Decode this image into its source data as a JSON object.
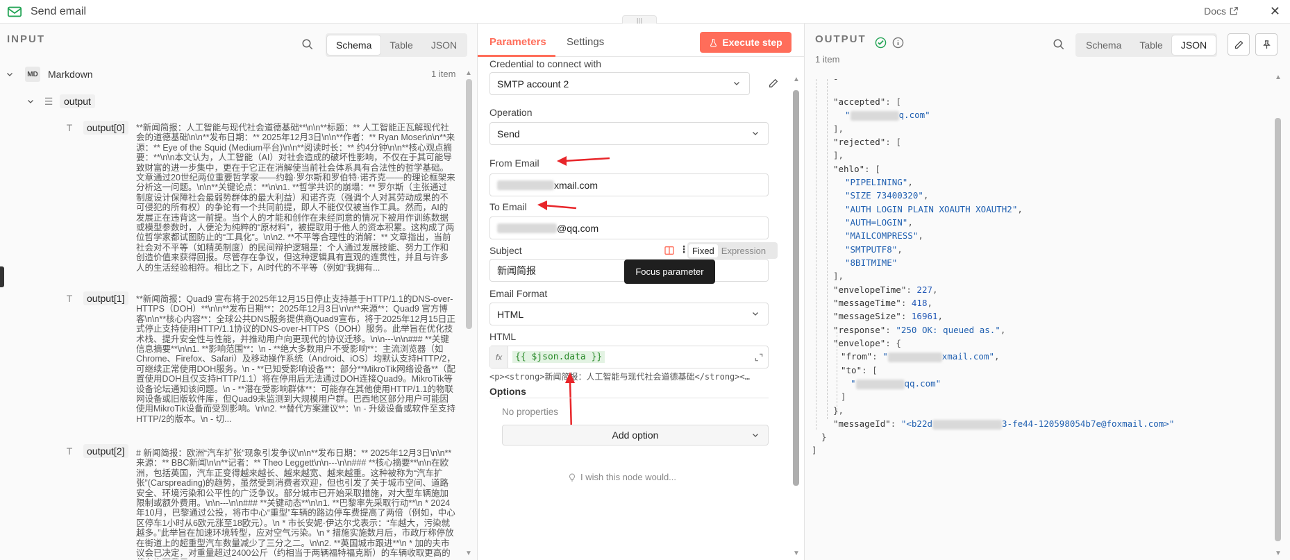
{
  "window": {
    "title": "Send email",
    "docs_label": "Docs",
    "close": "✕",
    "handle": "|||"
  },
  "input": {
    "header": "INPUT",
    "view_tabs": [
      "Schema",
      "Table",
      "JSON"
    ],
    "active_view": "Schema",
    "node": {
      "badge": "MD",
      "name": "Markdown",
      "count": "1 item"
    },
    "output_key": "output",
    "items": [
      {
        "key": "output[0]",
        "value": "**新闻简报：人工智能与现代社会道德基础**\\n\\n**标题：** 人工智能正瓦解现代社会的道德基础\\n\\n**发布日期：** 2025年12月3日\\n\\n**作者：** Ryan Moser\\n\\n**来源：** Eye of the Squid (Medium平台)\\n\\n**阅读时长：** 约4分钟\\n\\n**核心观点摘要：**\\n\\n本文认为，人工智能（AI）对社会造成的破坏性影响，不仅在于其可能导致财富的进一步集中，更在于它正在消解使当前社会体系具有合法性的哲学基础。文章通过20世纪两位重要哲学家——约翰·罗尔斯和罗伯特·诺齐克——的理论框架来分析这一问题。\\n\\n**关键论点：**\\n\\n1. **哲学共识的崩塌：** 罗尔斯（主张通过制度设计保障社会最弱势群体的最大利益）和诺齐克（强调个人对其劳动成果的不可侵犯的所有权）的争论有一个共同前提，即人不能仅仅被当作工具。然而，AI的发展正在违背这一前提。当个人的才能和创作在未经同意的情况下被用作训练数据或模型参数时，人便沦为纯粹的“原材料”，被提取用于他人的资本积累。这构成了两位哲学家都试图防止的“工具化”。\\n\\n2. **不平等合理性的消解：** 文章指出，当前社会对不平等（如精英制度）的民间辩护逻辑是：个人通过发展技能、努力工作和创造价值来获得回报。尽管存在争议，但这种逻辑具有直观的连贯性，并且与许多人的生活经验相符。相比之下，AI时代的不平等（例如“我拥有..."
      },
      {
        "key": "output[1]",
        "value": "**新闻简报：Quad9 宣布将于2025年12月15日停止支持基于HTTP/1.1的DNS-over-HTTPS（DOH）**\\n\\n**发布日期**：2025年12月3日\\n\\n**来源**：Quad9 官方博客\\n\\n**核心内容**：全球公共DNS服务提供商Quad9宣布，将于2025年12月15日正式停止支持使用HTTP/1.1协议的DNS-over-HTTPS（DOH）服务。此举旨在优化技术栈、提升安全性与性能，并推动用户向更现代的协议迁移。\\n\\n---\\n\\n### **关键信息摘要**\\n\\n1. **影响范围**：\\n - **绝大多数用户不受影响**：主流浏览器（如Chrome、Firefox、Safari）及移动操作系统（Android、iOS）均默认支持HTTP/2，可继续正常使用DOH服务。\\n - **已知受影响设备**：部分**MikroTik网络设备**（配置使用DOH且仅支持HTTP/1.1）将在停用后无法通过DOH连接Quad9。MikroTik等设备论坛通知该问题。\\n - **潜在受影响群体**：可能存在其他使用HTTP/1.1的物联网设备或旧版软件库，但Quad9未监测到大规模用户群。巴西地区部分用户可能因使用MikroTik设备而受到影响。\\n\\n2. **替代方案建议**：\\n - 升级设备或软件至支持HTTP/2的版本。\\n - 切..."
      },
      {
        "key": "output[2]",
        "value": "# 新闻简报：欧洲“汽车扩张”现象引发争议\\n\\n**发布日期：** 2025年12月3日\\n\\n**来源：** BBC新闻\\n\\n**记者：** Theo Leggett\\n\\n---\\n\\n### **核心摘要**\\n\\n在欧洲，包括英国，汽车正变得越来越长、越来越宽、越来越重。这种被称为“汽车扩张”(Carspreading)的趋势，虽然受到消费者欢迎，但也引发了关于城市空间、道路安全、环境污染和公平性的广泛争议。部分城市已开始采取措施，对大型车辆施加限制或额外费用。\\n\\n---\\n\\n### **关键动态**\\n\\n1. **巴黎率先采取行动**\\n * 2024年10月，巴黎通过公投，将市中心“重型”车辆的路边停车费提高了两倍（例如，中心区停车1小时从6欧元涨至18欧元）。\\n * 市长安妮·伊达尔戈表示：“车越大，污染就越多。”此举旨在加速环境转型，应对空气污染。\\n * 措施实施数月后，市政厅称停放在街道上的超重型汽车数量减少了三分之二。\\n\\n2. **英国城市跟进**\\n * 加的夫市议会已决定，对重量超过2400公斤（约相当于两辆福特福克斯）的车辆收取更高的停车许可费用..."
      }
    ]
  },
  "params": {
    "tabs": [
      "Parameters",
      "Settings"
    ],
    "active_tab": "Parameters",
    "execute_label": "Execute step",
    "credential_label": "Credential to connect with",
    "credential_value": "SMTP account 2",
    "operation_label": "Operation",
    "operation_value": "Send",
    "from_label": "From Email",
    "from_value_suffix": "xmail.com",
    "to_label": "To Email",
    "to_value_suffix": "@qq.com",
    "subject_label": "Subject",
    "subject_value": "新闻简报",
    "fixed_label": "Fixed",
    "expression_label": "Expression",
    "focus_tooltip": "Focus parameter",
    "format_label": "Email Format",
    "format_value": "HTML",
    "html_label": "HTML",
    "fx_label": "fx",
    "html_expression": "{{ $json.data }}",
    "html_preview": "<p><strong>新闻简报：人工智能与现代社会道德基础</strong><…",
    "options_label": "Options",
    "no_properties": "No properties",
    "add_option_label": "Add option",
    "feedback_label": "I wish this node would..."
  },
  "output": {
    "header": "OUTPUT",
    "view_tabs": [
      "Schema",
      "Table",
      "JSON"
    ],
    "active_view": "JSON",
    "count": "1 item",
    "json": {
      "accepted_key": "\"accepted\"",
      "accepted_suffix": "q.com\"",
      "rejected_key": "\"rejected\"",
      "ehlo_key": "\"ehlo\"",
      "ehlo": [
        "\"PIPELINING\"",
        "\"SIZE 73400320\"",
        "\"AUTH LOGIN PLAIN XOAUTH XOAUTH2\"",
        "\"AUTH=LOGIN\"",
        "\"MAILCOMPRESS\"",
        "\"SMTPUTF8\"",
        "\"8BITMIME\""
      ],
      "envelopeTime_key": "\"envelopeTime\"",
      "envelopeTime": "227",
      "messageTime_key": "\"messageTime\"",
      "messageTime": "418",
      "messageSize_key": "\"messageSize\"",
      "messageSize": "16961",
      "response_key": "\"response\"",
      "response": "\"250 OK: queued as.\"",
      "envelope_key": "\"envelope\"",
      "from_key": "\"from\"",
      "from_suffix": "xmail.com\"",
      "to_key": "\"to\"",
      "to_suffix": "qq.com\"",
      "messageId_key": "\"messageId\"",
      "messageId_prefix": "\"<b22d",
      "messageId_suffix": "3-fe44-120598054b7e@foxmail.com>\""
    }
  },
  "colors": {
    "accent": "#ff6d5a",
    "success": "#23a455",
    "tooltip": "#1f1f1f",
    "annotation": "#e8262a"
  }
}
